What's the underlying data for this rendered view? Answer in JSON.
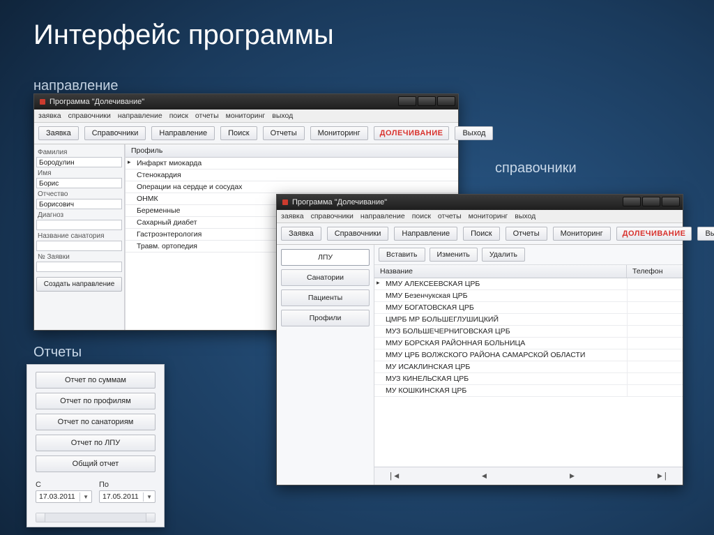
{
  "slide": {
    "title": "Интерфейс программы",
    "caption_direction": "направление",
    "caption_refs": "справочники",
    "caption_reports": "Отчеты"
  },
  "winCommon": {
    "title": "Программа \"Долечивание\"",
    "menu": [
      "заявка",
      "справочники",
      "направление",
      "поиск",
      "отчеты",
      "мониторинг",
      "выход"
    ],
    "toolbar": {
      "zayavka": "Заявка",
      "sprav": "Справочники",
      "naprav": "Направление",
      "poisk": "Поиск",
      "otchety": "Отчеты",
      "monitoring": "Мониторинг",
      "brand": "ДОЛЕЧИВАНИЕ",
      "exit": "Выход"
    }
  },
  "direction": {
    "form": {
      "lbl_surname": "Фамилия",
      "val_surname": "Бородулин",
      "lbl_name": "Имя",
      "val_name": "Борис",
      "lbl_patronymic": "Отчество",
      "val_patronymic": "Борисович",
      "lbl_diag": "Диагноз",
      "val_diag": "",
      "lbl_san": "Название санатория",
      "val_san": "",
      "lbl_num": "№ Заявки",
      "val_num": "",
      "btn_create": "Создать направление"
    },
    "listHeader": "Профиль",
    "profiles": [
      "Инфаркт миокарда",
      "Стенокардия",
      "Операции на сердце и сосудах",
      "ОНМК",
      "Беременные",
      "Сахарный диабет",
      "Гастроэнтерология",
      "Травм. ортопедия"
    ]
  },
  "refs": {
    "side": {
      "lpu": "ЛПУ",
      "san": "Санатории",
      "pac": "Пациенты",
      "prof": "Профили"
    },
    "actions": {
      "ins": "Вставить",
      "upd": "Изменить",
      "del": "Удалить"
    },
    "cols": {
      "name": "Название",
      "tel": "Телефон"
    },
    "rows": [
      "ММУ АЛЕКСЕЕВСКАЯ ЦРБ",
      "ММУ Безенчукская ЦРБ",
      "ММУ БОГАТОВСКАЯ ЦРБ",
      "ЦМРБ МР БОЛЬШЕГЛУШИЦКИЙ",
      "МУЗ БОЛЬШЕЧЕРНИГОВСКАЯ ЦРБ",
      "ММУ БОРСКАЯ РАЙОННАЯ БОЛЬНИЦА",
      "ММУ ЦРБ ВОЛЖСКОГО РАЙОНА САМАРСКОЙ ОБЛАСТИ",
      "МУ ИСАКЛИНСКАЯ ЦРБ",
      "МУЗ КИНЕЛЬСКАЯ ЦРБ",
      "МУ КОШКИНСКАЯ ЦРБ"
    ],
    "nav": {
      "first": "|◄",
      "prev": "◄",
      "next": "►",
      "last": "►|"
    }
  },
  "reports": {
    "btns": [
      "Отчет по суммам",
      "Отчет по профилям",
      "Отчет по санаториям",
      "Отчет по ЛПУ",
      "Общий отчет"
    ],
    "from_lbl": "С",
    "to_lbl": "По",
    "from_val": "17.03.2011",
    "to_val": "17.05.2011"
  }
}
